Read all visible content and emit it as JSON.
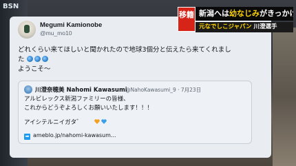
{
  "station": {
    "logo": "BSN"
  },
  "telop": {
    "badge": "移籍",
    "headline_pre": "新潟へは",
    "headline_hl": "幼なじみ",
    "headline_post": "がきっかけ",
    "sub_hl": "元なでしこジャパン",
    "sub_post": "川澄選手"
  },
  "tweet": {
    "author_name": "Megumi Kamionobe",
    "author_handle": "@mu_mo10",
    "line1": "どれくらい来てほしいと聞かれたので地球3個分と伝えたら来てくれまし",
    "line2_prefix": "た",
    "line3": "ようこそ〜",
    "globe_icons": [
      "globe-icon",
      "globe-icon",
      "globe-icon"
    ]
  },
  "quote": {
    "author_name": "川澄奈穂美 Nahomi Kawasumi",
    "author_handle": "@NahoKawasumi_9 · 7月23日",
    "line1": "アルビレックス新潟ファミリーの皆様、",
    "line2": "これからどうぞよろしくお願いいたします！！！",
    "line3": "アイシテルニイガタ゛",
    "hearts": [
      "orange-heart-icon",
      "blue-heart-icon"
    ],
    "link": "ameblo.jp/nahomi-kawasum..."
  },
  "colors": {
    "telop_red": "#d62418",
    "telop_yellow": "#ffd400",
    "card_bg": "#e9edf2"
  }
}
